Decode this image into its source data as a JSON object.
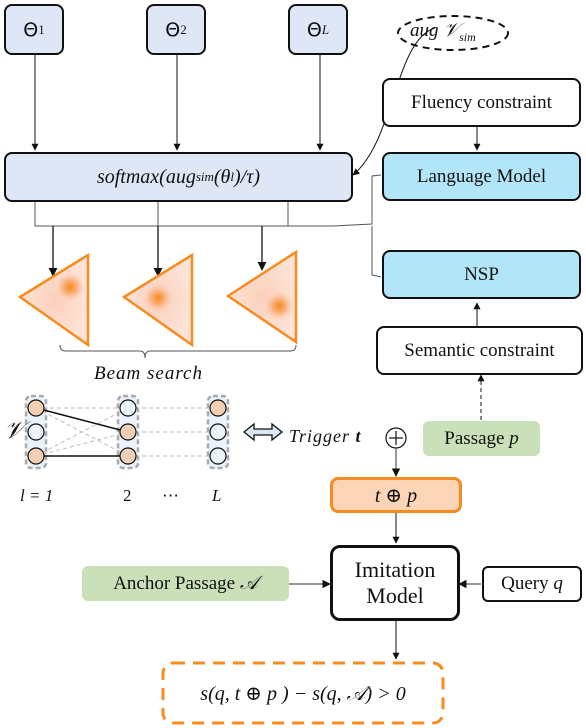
{
  "inputs": {
    "theta_1": {
      "symbol": "Θ",
      "sub": "1"
    },
    "theta_2": {
      "symbol": "Θ",
      "sub": "2"
    },
    "theta_L": {
      "symbol": "Θ",
      "sub": "L"
    }
  },
  "aug_vocab": {
    "prefix": "aug ",
    "symbol": "𝒱",
    "sub": "sim"
  },
  "softmax": {
    "pre": "softmax(aug",
    "sub": "sim",
    "post": "(θ",
    "sub2": "l",
    "end": ")/τ)"
  },
  "fluency": "Fluency constraint",
  "language_model": "Language Model",
  "nsp": "NSP",
  "semantic": "Semantic constraint",
  "beam_search": "Beam search",
  "vocab_symbol": "𝒱",
  "layer_labels": [
    "l = 1",
    "2",
    "⋯",
    "L"
  ],
  "trigger": {
    "text": "Trigger ",
    "bold": "t"
  },
  "oplus": "⊕",
  "passage": {
    "text": "Passage ",
    "var": "p"
  },
  "concat": "t ⊕ p",
  "anchor": {
    "text": "Anchor Passage ",
    "var": "𝒜"
  },
  "imitation": {
    "line1": "Imitation",
    "line2": "Model"
  },
  "query": {
    "text": "Query ",
    "var": "q"
  },
  "objective": "s(q, t ⊕ p ) − s(q, 𝒜) > 0",
  "colors": {
    "theta_fill": "#dfe6f5",
    "lm_fill": "#b3e5f8",
    "green_fill": "#c9e0b8",
    "orange": "#f68b1f",
    "orange_fill": "#fbd5b5",
    "node_selected": "#f5cfb3"
  }
}
